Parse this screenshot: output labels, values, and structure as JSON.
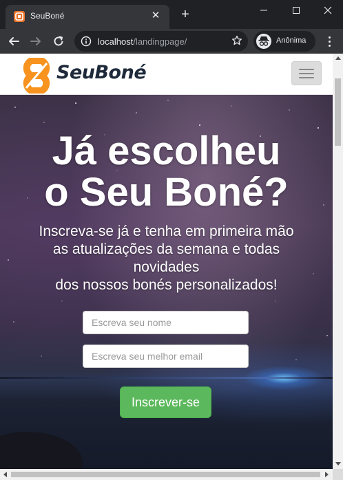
{
  "browser": {
    "tab_title": "SeuBoné",
    "url_host": "localhost",
    "url_path": "/landingpage/",
    "profile_label": "Anônima"
  },
  "navbar": {
    "brand": "SeuBoné",
    "brand_colors": {
      "mark": "#f7931e",
      "text": "#1e2a3a"
    }
  },
  "hero": {
    "title_line1": "Já escolheu",
    "title_line2": "o Seu Boné?",
    "subtitle_line1": "Inscreva-se já e tenha em primeira mão",
    "subtitle_line2": "as atualizações da semana e todas",
    "subtitle_line3": "novidades",
    "subtitle_line4": "dos nossos bonés personalizados!"
  },
  "form": {
    "name_placeholder": "Escreva seu nome",
    "email_placeholder": "Escreva seu melhor email",
    "submit_label": "Inscrever-se",
    "submit_color": "#5cb85c"
  }
}
